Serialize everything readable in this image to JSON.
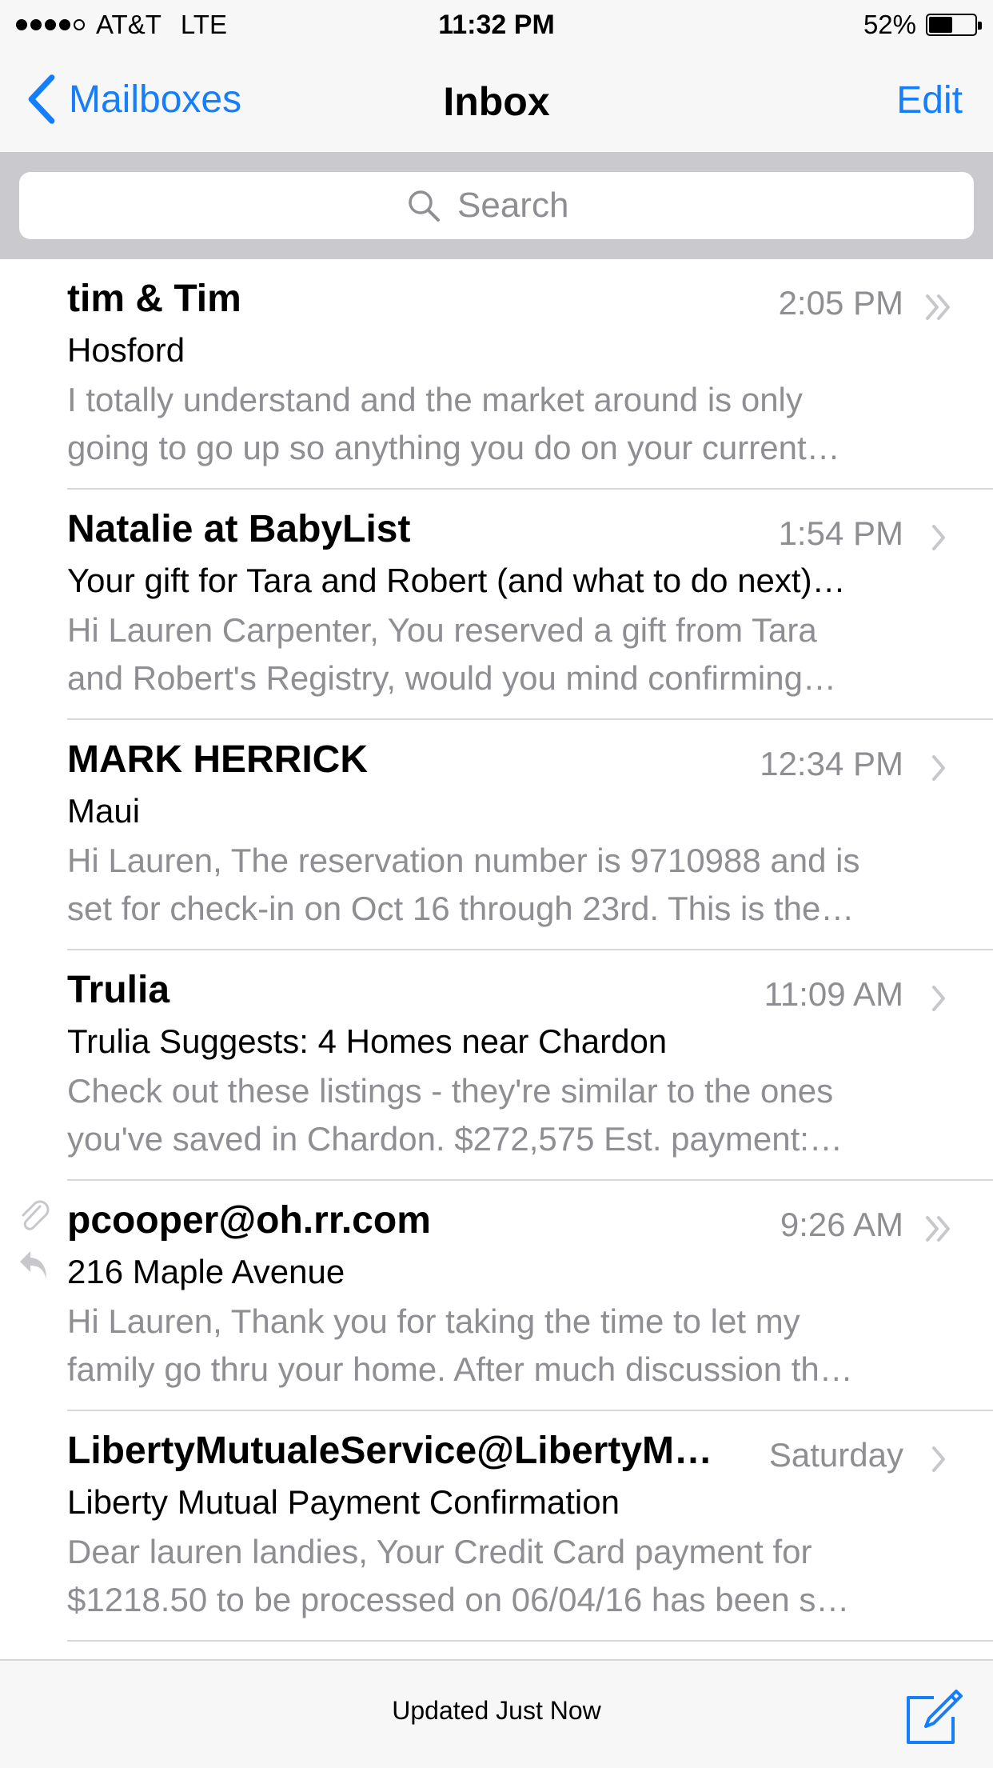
{
  "status": {
    "carrier": "AT&T",
    "network": "LTE",
    "time": "11:32 PM",
    "battery": "52%",
    "battery_level": 0.52,
    "signal_bars": 4
  },
  "nav": {
    "back_label": "Mailboxes",
    "title": "Inbox",
    "edit_label": "Edit"
  },
  "search": {
    "placeholder": "Search"
  },
  "emails": [
    {
      "sender": "tim & Tim",
      "time": "2:05 PM",
      "chevron": "double-chevron-icon",
      "subject": "Hosford",
      "preview_line1": "I totally understand and the market around is only",
      "preview_line2": "going to go up so anything you do on your current…"
    },
    {
      "sender": "Natalie at BabyList",
      "time": "1:54 PM",
      "chevron": "chevron-right-icon",
      "subject": "Your gift for Tara and Robert (and what to do next)…",
      "preview_line1": "Hi Lauren Carpenter, You reserved a gift from Tara",
      "preview_line2": "and Robert's Registry, would you mind confirming…"
    },
    {
      "sender": "MARK HERRICK",
      "time": "12:34 PM",
      "chevron": "chevron-right-icon",
      "subject": "Maui",
      "preview_line1": "Hi Lauren, The reservation number is 9710988 and is",
      "preview_line2": "set for check-in on Oct 16 through 23rd. This is the…"
    },
    {
      "sender": "Trulia",
      "time": "11:09 AM",
      "chevron": "chevron-right-icon",
      "subject": "Trulia Suggests: 4 Homes near Chardon",
      "preview_line1": "Check out these listings - they're similar to the ones",
      "preview_line2": "you've saved in Chardon. $272,575 Est. payment:…"
    },
    {
      "sender": "pcooper@oh.rr.com",
      "time": "9:26 AM",
      "chevron": "double-chevron-icon",
      "subject": "216 Maple Avenue",
      "preview_line1": "Hi Lauren, Thank you for taking the time to let my",
      "preview_line2": "family go thru your home. After much discussion th…",
      "icons": [
        "paperclip-icon",
        "reply-icon"
      ]
    },
    {
      "sender": "LibertyMutualeService@LibertyM…",
      "time": "Saturday",
      "chevron": "chevron-right-icon",
      "subject": "Liberty Mutual Payment Confirmation",
      "preview_line1": "Dear lauren landies, Your Credit Card payment for",
      "preview_line2": "$1218.50 to be processed on 06/04/16 has been s…"
    }
  ],
  "toolbar": {
    "updated_text": "Updated Just Now",
    "compose_icon": "compose-icon"
  },
  "colors": {
    "accent": "#147efb",
    "secondary_text": "#8e8e93",
    "bar_background": "#f7f7f7",
    "search_background": "#c9c9ce"
  }
}
